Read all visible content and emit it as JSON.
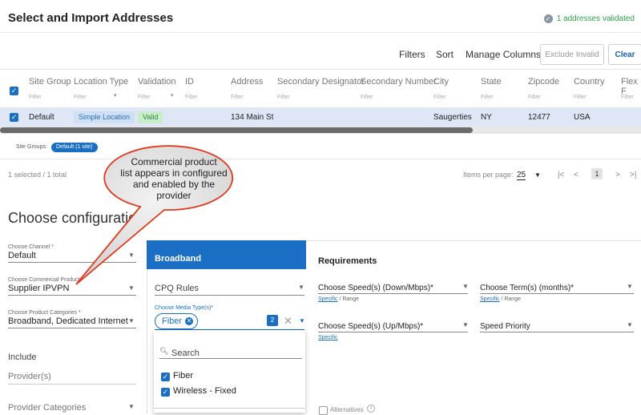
{
  "header": {
    "title": "Select and Import Addresses",
    "validated_text": "1 addresses validated"
  },
  "toolbar": {
    "filters": "Filters",
    "sort": "Sort",
    "manage_columns": "Manage Columns",
    "exclude_invalid": "Exclude Invalid",
    "clear": "Clear"
  },
  "table": {
    "columns": [
      "Site Group",
      "Location Type",
      "Validation",
      "ID",
      "Address",
      "Secondary Designator",
      "Secondary Number",
      "City",
      "State",
      "Zipcode",
      "Country",
      "Flex F"
    ],
    "filter_placeholder": "Filter",
    "row": {
      "site_group": "Default",
      "location_type": "Simple Location",
      "validation": "Valid",
      "id": "",
      "address": "134 Main St",
      "secondary_designator": "",
      "secondary_number": "",
      "city": "Saugerties",
      "state": "NY",
      "zipcode": "12477",
      "country": "USA"
    }
  },
  "site_groups": {
    "label": "Site Groups:",
    "pill": "Default (1 site)"
  },
  "pager": {
    "selected": "1 selected / 1 total",
    "items_per_page_label": "Items per page:",
    "items_per_page": "25",
    "first": "|<",
    "prev": "<",
    "page": "1",
    "next": ">",
    "last": ">|"
  },
  "callout": {
    "line1": "Commercial product",
    "line2": "list appears in configured",
    "line3": "and enabled by the",
    "line4": "provider"
  },
  "config": {
    "heading": "Choose configuration:",
    "channel_label": "Choose Channel *",
    "channel_value": "Default",
    "product_label": "Choose Commercial Product",
    "product_value": "Supplier IPVPN",
    "categories_label": "Choose Product Categories *",
    "categories_value": "Broadband, Dedicated Internet",
    "include": "Include",
    "providers": "Provider(s)",
    "provider_categories": "Provider Categories"
  },
  "panel": {
    "tab": "Broadband",
    "cpq_rules": "CPQ Rules",
    "media_label": "Choose Media Type(s)*",
    "media_pill": "Fiber",
    "media_count": "2",
    "search_placeholder": "Search",
    "options": [
      "Fiber",
      "Wireless - Fixed"
    ],
    "requirements": "Requirements",
    "speed_down": "Choose Speed(s) (Down/Mbps)*",
    "speed_up": "Choose Speed(s) (Up/Mbps)*",
    "term": "Choose Term(s) (months)*",
    "speed_priority": "Speed Priority",
    "specific": "Specific",
    "range": "/ Range",
    "alternatives": "Alternatives"
  },
  "colors": {
    "primary": "#1a6fc4",
    "valid": "#2e9e4f",
    "row_highlight": "#dfe6f5",
    "callout_fill": "#e6e6e6",
    "callout_stroke": "#e03a1e"
  }
}
